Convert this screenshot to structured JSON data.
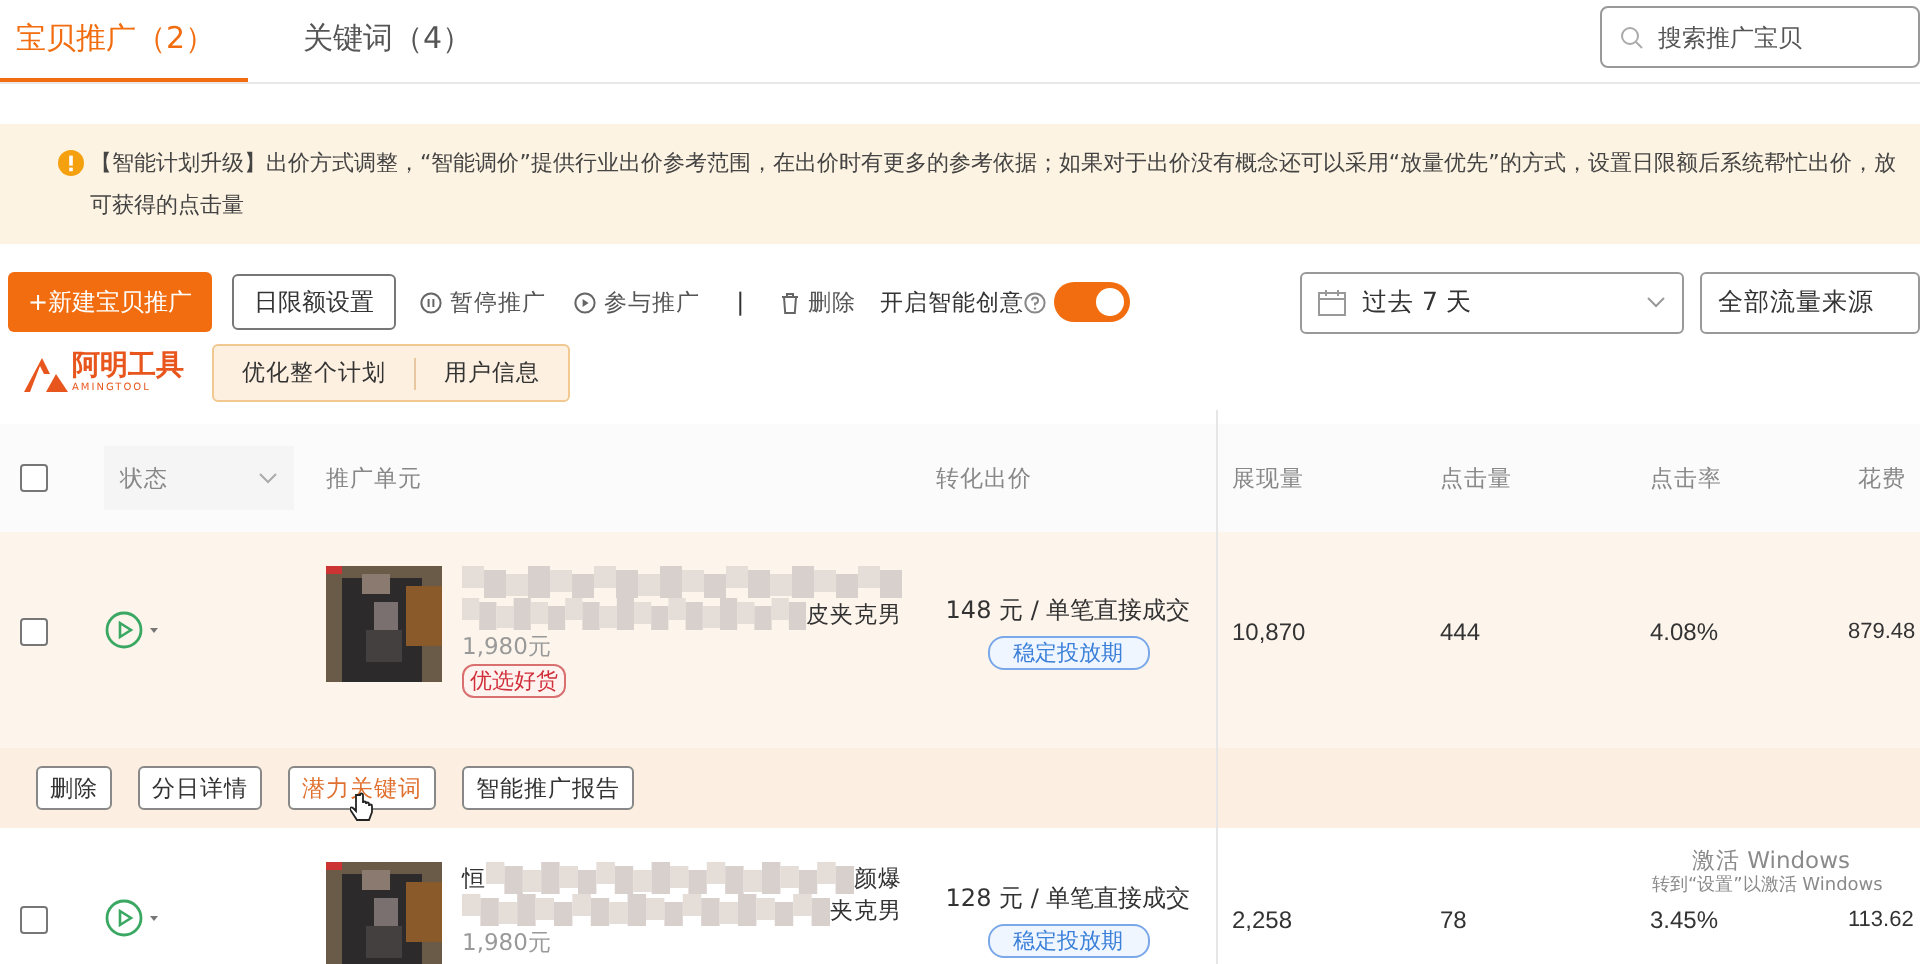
{
  "tabs": [
    {
      "label": "宝贝推广（2）",
      "selected": true
    },
    {
      "label": "关键词（4）",
      "selected": false
    }
  ],
  "search": {
    "placeholder": "搜索推广宝贝"
  },
  "notice": {
    "text": "【智能计划升级】出价方式调整，“智能调价”提供行业出价参考范围，在出价时有更多的参考依据；如果对于出价没有概念还可以采用“放量优先”的方式，设置日限额后系统帮忙出价，放可获得的点击量"
  },
  "toolbar": {
    "new_button": "+新建宝贝推广",
    "limit_button": "日限额设置",
    "actions": [
      {
        "kind": "pause",
        "label": "暂停推广"
      },
      {
        "kind": "join",
        "label": "参与推广"
      },
      {
        "kind": "separator",
        "label": "|"
      },
      {
        "kind": "delete",
        "label": "删除"
      }
    ],
    "smart_creative": {
      "label": "开启智能创意",
      "on": true
    },
    "date_range": "过去 7 天",
    "traffic_source": "全部流量来源"
  },
  "plugin": {
    "logo": "阿明工具",
    "logo_sub": "AMINGTOOL",
    "buttons": [
      "优化整个计划",
      "用户信息"
    ]
  },
  "table": {
    "select_all_checked": false,
    "columns": [
      "状态",
      "推广单元",
      "转化出价",
      "展现量",
      "点击量",
      "点击率",
      "花费"
    ],
    "rows": [
      {
        "checked": false,
        "highlighted": true,
        "title_line_2": {
          "end": "皮夹克男"
        },
        "price": "1,980元",
        "tag": "优选好货",
        "bid": "148 元 / 单笔直接成交",
        "bid_tag": "稳定投放期",
        "impressions": "10,870",
        "clicks": "444",
        "ctr": "4.08%",
        "cost": "879.48",
        "actions": [
          {
            "label": "删除",
            "hovered": false
          },
          {
            "label": "分日详情",
            "hovered": false
          },
          {
            "label": "潜力关键词",
            "hovered": true
          },
          {
            "label": "智能推广报告",
            "hovered": false
          }
        ]
      },
      {
        "checked": false,
        "highlighted": false,
        "title_line_1": {
          "start": "恒",
          "end": "颜爆"
        },
        "title_line_2": {
          "end": "夹克男"
        },
        "price": "1,980元",
        "bid": "128 元 / 单笔直接成交",
        "bid_tag": "稳定投放期",
        "impressions": "2,258",
        "clicks": "78",
        "ctr": "3.45%",
        "cost": "113.62"
      }
    ]
  },
  "os_notice": {
    "title": "激活 Windows",
    "text": "转到“设置”以激活 Windows"
  }
}
